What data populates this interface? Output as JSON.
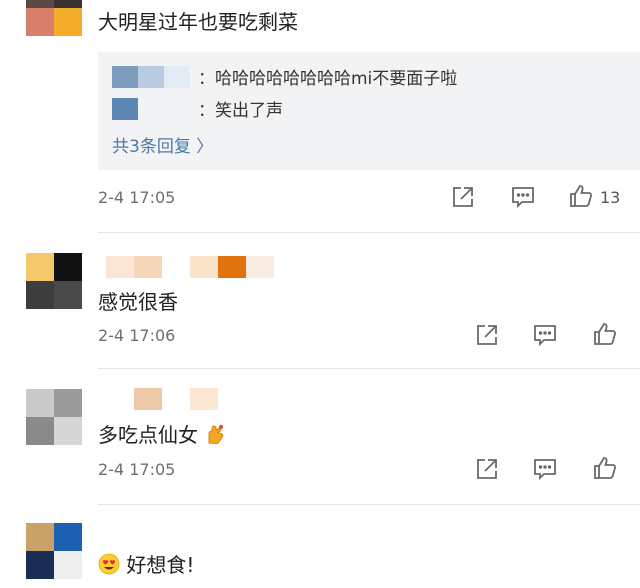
{
  "comments": [
    {
      "text": "大明星过年也要吃剩菜",
      "time": "2-4 17:05",
      "replies": [
        {
          "text": "：哈哈哈哈哈哈哈哈mi不要面子啦"
        },
        {
          "text": "：笑出了声"
        }
      ],
      "reply_summary": "共3条回复 〉",
      "like_count": "13"
    },
    {
      "text": "感觉很香",
      "time": "2-4 17:06"
    },
    {
      "text": "多吃点仙女",
      "time": "2-4 17:05"
    },
    {
      "text": "好想食!"
    }
  ],
  "icons": {
    "share": "share-icon",
    "comment": "comment-icon",
    "like": "thumbs-up-icon"
  },
  "colors": {
    "link": "#4e77a8",
    "reply_bg": "#f2f3f5",
    "time": "#6f6f6f"
  }
}
